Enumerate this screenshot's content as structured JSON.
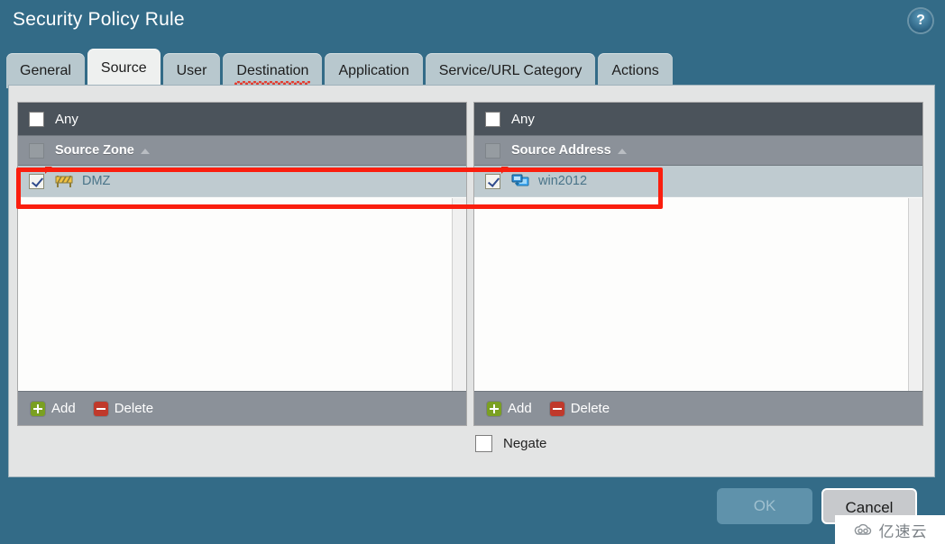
{
  "dialog": {
    "title": "Security Policy Rule",
    "help_icon": "help-circle-icon",
    "help_glyph": "?"
  },
  "tabs": [
    {
      "label": "General",
      "active": false,
      "misspelled": false
    },
    {
      "label": "Source",
      "active": true,
      "misspelled": false
    },
    {
      "label": "User",
      "active": false,
      "misspelled": false
    },
    {
      "label": "Destination",
      "active": false,
      "misspelled": true
    },
    {
      "label": "Application",
      "active": false,
      "misspelled": false
    },
    {
      "label": "Service/URL Category",
      "active": false,
      "misspelled": false
    },
    {
      "label": "Actions",
      "active": false,
      "misspelled": false
    }
  ],
  "panels": {
    "source_zone": {
      "any_label": "Any",
      "any_checked": false,
      "column_header": "Source Zone",
      "sort_direction": "ascending",
      "header_checkbox_disabled": true,
      "rows": [
        {
          "label": "DMZ",
          "checked": true,
          "icon": "zone-barrier-icon",
          "flagged": true
        }
      ],
      "add_label": "Add",
      "delete_label": "Delete"
    },
    "source_address": {
      "any_label": "Any",
      "any_checked": false,
      "column_header": "Source Address",
      "sort_direction": "ascending",
      "header_checkbox_disabled": true,
      "rows": [
        {
          "label": "win2012",
          "checked": true,
          "icon": "computer-monitor-icon",
          "flagged": true
        }
      ],
      "add_label": "Add",
      "delete_label": "Delete"
    }
  },
  "negate": {
    "label": "Negate",
    "checked": false
  },
  "footer": {
    "ok_label": "OK",
    "ok_disabled": true,
    "cancel_label": "Cancel"
  },
  "watermark": {
    "text": "亿速云",
    "logo": "cloud-logo-icon"
  },
  "colors": {
    "dialog_background": "#336b87",
    "content_background": "#e3e4e4",
    "any_row": "#4b535b",
    "column_header": "#8b9199",
    "selected_row": "#bfcbd0",
    "row_link_text": "#4a7489",
    "tab_inactive": "#b8c8ce",
    "tab_active": "#eef0ef",
    "annotation": "#fa1e0e",
    "add_icon": "#7aa021",
    "delete_icon": "#c0392b",
    "ok_button": "#5f92ab",
    "cancel_button": "#c7c9cc"
  }
}
